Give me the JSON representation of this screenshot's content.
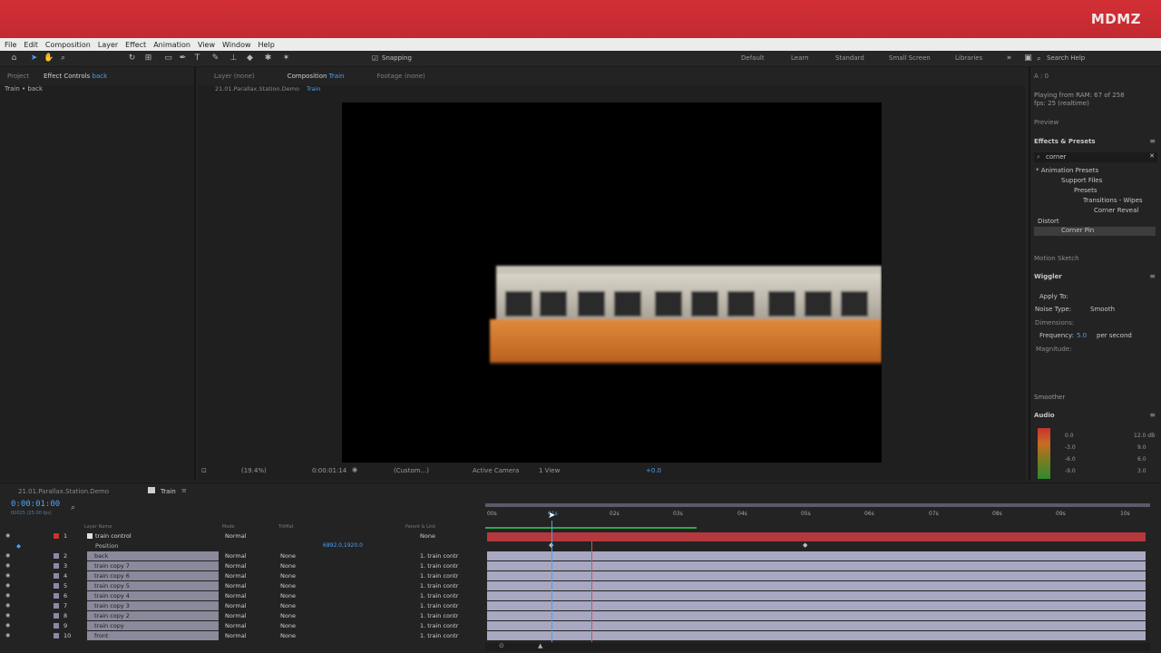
{
  "brand": "MDMZ",
  "menu": [
    "File",
    "Edit",
    "Composition",
    "Layer",
    "Effect",
    "Animation",
    "View",
    "Window",
    "Help"
  ],
  "toolbar": {
    "snapping_label": "Snapping",
    "workspaces": [
      "Default",
      "Learn",
      "Standard",
      "Small Screen",
      "Libraries"
    ],
    "search_help": "Search Help"
  },
  "left_panel": {
    "tab_project": "Project",
    "tab_effect_controls": "Effect Controls",
    "tab_effect_controls_target": "back",
    "breadcrumb": "Train • back"
  },
  "comp_panel": {
    "tab_layer": "Layer",
    "tab_layer_value": "(none)",
    "tab_composition": "Composition",
    "tab_composition_name": "Train",
    "tab_footage": "Footage",
    "tab_footage_value": "(none)",
    "breadcrumb_project": "21.01.Parallax.Station.Demo",
    "breadcrumb_comp": "Train",
    "zoom": "(19.4%)",
    "timecode": "0:00:01:14",
    "resolution": "(Custom...)",
    "camera": "Active Camera",
    "views": "1 View",
    "exposure": "+0.0"
  },
  "right_panel": {
    "info_a": "A : 0",
    "ram_info": "Playing from RAM: 67 of 258",
    "fps_info": "fps: 25 (realtime)",
    "preview_label": "Preview",
    "effects_presets_label": "Effects & Presets",
    "search_value": "corner",
    "tree": [
      "* Animation Presets",
      "Support Files",
      "Presets",
      "Transitions - Wipes",
      "Corner Reveal",
      "Distort",
      "Corner Pin"
    ],
    "motion_sketch": "Motion Sketch",
    "wiggler": "Wiggler",
    "apply_to": "Apply To:",
    "noise_type_label": "Noise Type:",
    "noise_type_value": "Smooth",
    "dimensions_label": "Dimensions:",
    "frequency_label": "Frequency:",
    "frequency_value": "5.0",
    "frequency_unit": "per second",
    "magnitude_label": "Magnitude:",
    "smoother": "Smoother",
    "audio": "Audio",
    "db_left": [
      "0.0",
      "-3.0",
      "-6.0",
      "-9.0"
    ],
    "db_right": [
      "12.0 dB",
      "9.0",
      "6.0",
      "3.0"
    ]
  },
  "timeline": {
    "tab_project": "21.01.Parallax.Station.Demo",
    "tab_comp": "Train",
    "timecode": "0:00:01:00",
    "fps_sub": "00025 (25.00 fps)",
    "col_layer_name": "Layer Name",
    "col_mode": "Mode",
    "col_trkmat": "TrkMat",
    "col_parent": "Parent & Link",
    "ruler": [
      "00s",
      "01s",
      "02s",
      "03s",
      "04s",
      "05s",
      "06s",
      "07s",
      "08s",
      "09s",
      "10s"
    ],
    "layers": [
      {
        "num": "1",
        "name": "train control",
        "mode": "Normal",
        "trk": "",
        "parent": "None"
      },
      {
        "num": "",
        "name": "Position",
        "mode": "",
        "trk": "",
        "parent": "",
        "value": "6892.0,1920.0"
      },
      {
        "num": "2",
        "name": "back",
        "mode": "Normal",
        "trk": "None",
        "parent": "1. train contr"
      },
      {
        "num": "3",
        "name": "train copy 7",
        "mode": "Normal",
        "trk": "None",
        "parent": "1. train contr"
      },
      {
        "num": "4",
        "name": "train copy 6",
        "mode": "Normal",
        "trk": "None",
        "parent": "1. train contr"
      },
      {
        "num": "5",
        "name": "train copy 5",
        "mode": "Normal",
        "trk": "None",
        "parent": "1. train contr"
      },
      {
        "num": "6",
        "name": "train copy 4",
        "mode": "Normal",
        "trk": "None",
        "parent": "1. train contr"
      },
      {
        "num": "7",
        "name": "train copy 3",
        "mode": "Normal",
        "trk": "None",
        "parent": "1. train contr"
      },
      {
        "num": "8",
        "name": "train copy 2",
        "mode": "Normal",
        "trk": "None",
        "parent": "1. train contr"
      },
      {
        "num": "9",
        "name": "train copy",
        "mode": "Normal",
        "trk": "None",
        "parent": "1. train contr"
      },
      {
        "num": "10",
        "name": "front",
        "mode": "Normal",
        "trk": "None",
        "parent": "1. train contr"
      }
    ]
  },
  "colors": {
    "banner": "#c9262e",
    "accent_blue": "#4f9ff0",
    "layer_bar": "#a8a8c2",
    "playhead": "#e0485a"
  }
}
